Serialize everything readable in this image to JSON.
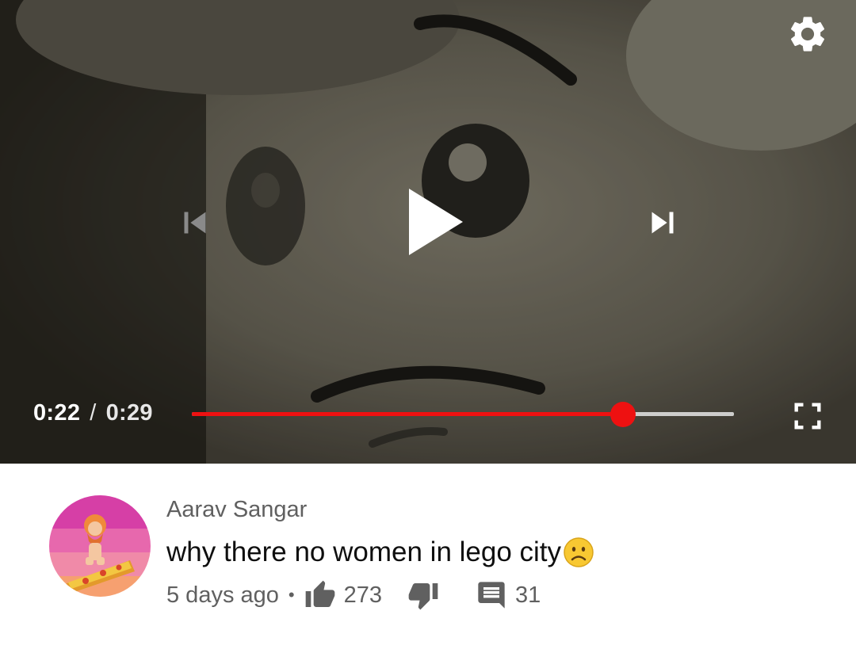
{
  "player": {
    "current_time": "0:22",
    "separator": "/",
    "duration": "0:29",
    "progress_fraction": 0.796,
    "accent_color": "#ee1111",
    "icons": {
      "settings": "gear-icon",
      "previous": "skip-previous-icon",
      "play": "play-icon",
      "next": "skip-next-icon",
      "fullscreen": "fullscreen-icon"
    }
  },
  "comment": {
    "author": "Aarav Sangar",
    "text": "why there no women in lego city",
    "emoji": "frowning-face-emoji",
    "age": "5 days ago",
    "bullet": "•",
    "likes": "273",
    "replies": "31",
    "icons": {
      "like": "thumbs-up-icon",
      "dislike": "thumbs-down-icon",
      "reply": "comment-icon"
    }
  }
}
